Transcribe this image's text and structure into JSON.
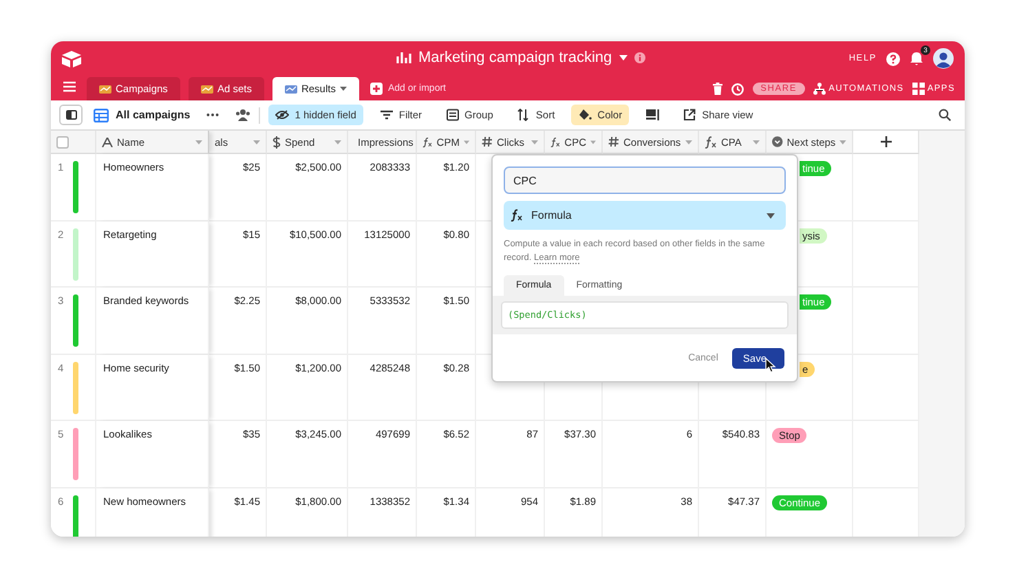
{
  "app_header": {
    "title": "Marketing campaign tracking",
    "help": "HELP",
    "notification_count": "3"
  },
  "tabs": [
    {
      "label": "Campaigns",
      "selected": false
    },
    {
      "label": "Ad sets",
      "selected": false
    },
    {
      "label": "Results",
      "selected": true
    }
  ],
  "add_table": "Add or import",
  "header_actions": {
    "share": "SHARE",
    "automations": "AUTOMATIONS",
    "apps": "APPS"
  },
  "toolbar": {
    "view_name": "All campaigns",
    "buttons": [
      {
        "kind": "hide",
        "label": "1 hidden field",
        "active": true
      },
      {
        "kind": "filter",
        "label": "Filter",
        "active": false
      },
      {
        "kind": "group",
        "label": "Group",
        "active": false
      },
      {
        "kind": "sort",
        "label": "Sort",
        "active": false
      },
      {
        "kind": "color",
        "label": "Color",
        "active": true
      },
      {
        "kind": "rowheight",
        "active": false
      },
      {
        "kind": "share",
        "label": "Share view",
        "active": false
      }
    ]
  },
  "table": {
    "select_all": {
      "checked": false
    },
    "columns": [
      {
        "label": "Name",
        "kind": "text"
      },
      {
        "label": "als",
        "kind": "cut"
      },
      {
        "label": "Spend",
        "kind": "currency"
      },
      {
        "label": "Impressions",
        "kind": "number"
      },
      {
        "label": "CPM",
        "kind": "formula"
      },
      {
        "label": "Clicks",
        "kind": "number"
      },
      {
        "label": "CPC",
        "kind": "formula"
      },
      {
        "label": "Conversions",
        "kind": "number"
      },
      {
        "label": "CPA",
        "kind": "formula"
      },
      {
        "label": "Next steps",
        "kind": "select"
      }
    ],
    "rows": [
      {
        "number": "1",
        "color": "#20c933",
        "name": "Homeowners",
        "column_2": "$25",
        "spend": "$2,500.00",
        "impressions": "2083333",
        "cpm": "$1.20",
        "next_step": {
          "label": "tinue",
          "color": "#20c933",
          "clipped": true
        }
      },
      {
        "number": "2",
        "color": "#c2f5c9",
        "name": "Retargeting",
        "column_2": "$15",
        "spend": "$10,500.00",
        "impressions": "13125000",
        "cpm": "$0.80",
        "next_step": {
          "label": "ysis",
          "color": "#d1f7c4",
          "clipped": true
        }
      },
      {
        "number": "3",
        "color": "#20c933",
        "name": "Branded keywords",
        "column_2": "$2.25",
        "spend": "$8,000.00",
        "impressions": "5333532",
        "cpm": "$1.50",
        "next_step": {
          "label": "tinue",
          "color": "#20c933",
          "clipped": true
        }
      },
      {
        "number": "4",
        "color": "#ffd66e",
        "name": "Home security",
        "column_2": "$1.50",
        "spend": "$1,200.00",
        "impressions": "4285248",
        "cpm": "$0.28",
        "next_step": {
          "label": "e",
          "color": "#ffd66e",
          "clipped": true
        }
      },
      {
        "number": "5",
        "color": "#ff9eb7",
        "name": "Lookalikes",
        "column_2": "$35",
        "spend": "$3,245.00",
        "impressions": "497699",
        "cpm": "$6.52",
        "clicks": "87",
        "cpc": "$37.30",
        "conversions": "6",
        "cpa": "$540.83",
        "next_step": {
          "label": "Stop",
          "color": "#ff9eb7",
          "clipped": false
        }
      },
      {
        "number": "6",
        "color": "#20c933",
        "name": "New homeowners",
        "column_2": "$1.45",
        "spend": "$1,800.00",
        "impressions": "1338352",
        "cpm": "$1.34",
        "clicks": "954",
        "cpc": "$1.89",
        "conversions": "38",
        "cpa": "$47.37",
        "next_step": {
          "label": "Continue",
          "color": "#20c933",
          "clipped": false
        }
      }
    ]
  },
  "field_editor": {
    "field_name": "CPC",
    "field_type": "Formula",
    "description": "Compute a value in each record based on other fields in the same record.",
    "link": "Learn more",
    "tabs": [
      {
        "label": "Formula",
        "selected": true
      },
      {
        "label": "Formatting",
        "selected": false
      }
    ],
    "formula": "(Spend/Clicks)",
    "cancel": "Cancel",
    "save": "Save"
  }
}
